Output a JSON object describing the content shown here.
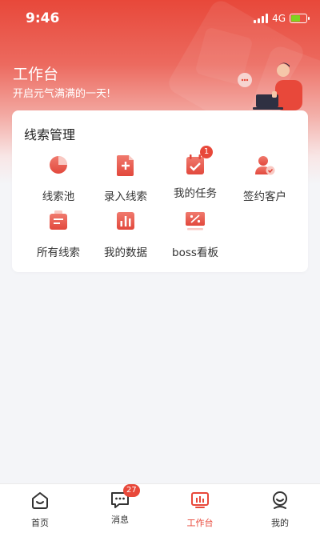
{
  "status_bar": {
    "time": "9:46",
    "network": "4G"
  },
  "header": {
    "title": "工作台",
    "subtitle": "开启元气满满的一天!"
  },
  "card": {
    "title": "线索管理",
    "items": [
      {
        "label": "线索池",
        "icon": "pie-chart-icon"
      },
      {
        "label": "录入线索",
        "icon": "add-document-icon"
      },
      {
        "label": "我的任务",
        "icon": "calendar-task-icon",
        "badge": "1"
      },
      {
        "label": "签约客户",
        "icon": "user-check-icon"
      },
      {
        "label": "所有线索",
        "icon": "folder-icon"
      },
      {
        "label": "我的数据",
        "icon": "bar-chart-icon"
      },
      {
        "label": "boss看板",
        "icon": "monitor-board-icon"
      }
    ]
  },
  "tabbar": {
    "tabs": [
      {
        "label": "首页",
        "icon": "home-icon"
      },
      {
        "label": "消息",
        "icon": "message-icon",
        "badge": "27"
      },
      {
        "label": "工作台",
        "icon": "workbench-icon",
        "active": true
      },
      {
        "label": "我的",
        "icon": "profile-icon"
      }
    ]
  },
  "colors": {
    "accent": "#e8483a",
    "icon_gradient_top": "#f07a6e",
    "icon_gradient_bottom": "#e2483c"
  }
}
